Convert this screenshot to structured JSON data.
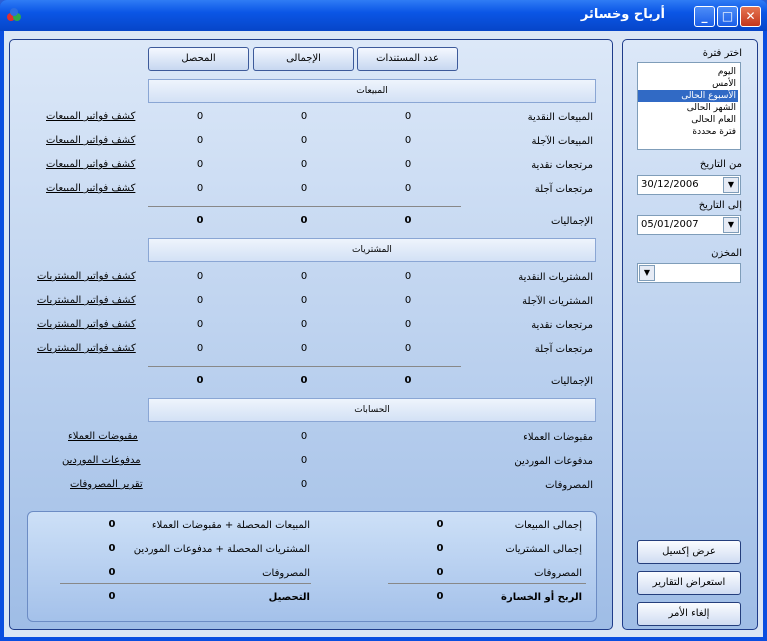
{
  "window": {
    "title": "أرباح وخسائر",
    "min": "_",
    "max": "□",
    "close": "✕"
  },
  "headers": {
    "collected": "المحصل",
    "total": "الإجمالى",
    "docs": "عدد المستندات"
  },
  "sales": {
    "band": "المبيعات",
    "rows": [
      {
        "label": "المبيعات النقدية",
        "docs": "0",
        "total": "0",
        "collected": "0",
        "link": "كشف فواتير المبيعات"
      },
      {
        "label": "المبيعات الآجلة",
        "docs": "0",
        "total": "0",
        "collected": "0",
        "link": "كشف فواتير المبيعات"
      },
      {
        "label": "مرتجعات نقدية",
        "docs": "0",
        "total": "0",
        "collected": "0",
        "link": "كشف فواتير المبيعات"
      },
      {
        "label": "مرتجعات آجلة",
        "docs": "0",
        "total": "0",
        "collected": "0",
        "link": "كشف فواتير المبيعات"
      }
    ],
    "totals": {
      "label": "الإجماليات",
      "docs": "0",
      "total": "0",
      "collected": "0"
    }
  },
  "purchases": {
    "band": "المشتريات",
    "rows": [
      {
        "label": "المشتريات النقدية",
        "docs": "0",
        "total": "0",
        "collected": "0",
        "link": "كشف فواتير المشتريات"
      },
      {
        "label": "المشتريات الآجلة",
        "docs": "0",
        "total": "0",
        "collected": "0",
        "link": "كشف فواتير المشتريات"
      },
      {
        "label": "مرتجعات نقدية",
        "docs": "0",
        "total": "0",
        "collected": "0",
        "link": "كشف فواتير المشتريات"
      },
      {
        "label": "مرتجعات آجلة",
        "docs": "0",
        "total": "0",
        "collected": "0",
        "link": "كشف فواتير المشتريات"
      }
    ],
    "totals": {
      "label": "الإجماليات",
      "docs": "0",
      "total": "0",
      "collected": "0"
    }
  },
  "accounts": {
    "band": "الحسابات",
    "rows": [
      {
        "label": "مقبوضات العملاء",
        "total": "0",
        "link": "مقبوضات العملاء"
      },
      {
        "label": "مدفوعات الموردين",
        "total": "0",
        "link": "مدفوعات الموردين"
      },
      {
        "label": "المصروفات",
        "total": "0",
        "link": "تقرير المصروفات"
      }
    ]
  },
  "summary": {
    "right": [
      {
        "label": "إجمالى المبيعات",
        "value": "0"
      },
      {
        "label": "إجمالى المشتريات",
        "value": "0"
      },
      {
        "label": "المصروفات",
        "value": "0"
      },
      {
        "label": "الربح أو الخسارة",
        "value": "0"
      }
    ],
    "left": [
      {
        "label": "المبيعات المحصلة + مقبوضات العملاء",
        "value": "0"
      },
      {
        "label": "المشتريات المحصلة + مدفوعات الموردين",
        "value": "0"
      },
      {
        "label": "المصروفات",
        "value": "0"
      },
      {
        "label": "التحصيل",
        "value": "0"
      }
    ]
  },
  "side": {
    "period_label": "اختر فترة",
    "periods": [
      "اليوم",
      "الأمس",
      "الأسبوع الحالى",
      "الشهر الحالى",
      "العام الحالى",
      "فترة محددة"
    ],
    "selected_index": 2,
    "from_label": "من التاريخ",
    "from_value": "30/12/2006",
    "to_label": "إلى التاريخ",
    "to_value": "05/01/2007",
    "store_label": "المخزن",
    "store_value": "",
    "excel": "عرض إكسيل",
    "reports": "استعراض التقارير",
    "cancel": "إلغاء الأمر"
  },
  "colors": {
    "title_bar": "#0b56e6",
    "panel": "#b9cfee",
    "selected": "#316ac5"
  }
}
